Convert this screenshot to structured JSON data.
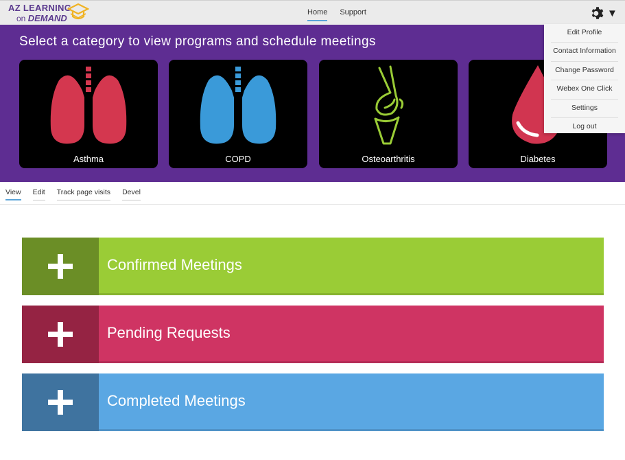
{
  "brand": {
    "line1": "AZ LEARNING",
    "line2_prefix": "on",
    "line2_emph": "DEMAND"
  },
  "topnav": {
    "items": [
      {
        "label": "Home",
        "active": true
      },
      {
        "label": "Support",
        "active": false
      }
    ]
  },
  "banner": {
    "title": "Select a category to view programs and schedule meetings"
  },
  "categories": [
    {
      "label": "Asthma",
      "icon": "lungs-icon",
      "color": "#d4374f"
    },
    {
      "label": "COPD",
      "icon": "lungs-icon",
      "color": "#3a9ad9"
    },
    {
      "label": "Osteoarthritis",
      "icon": "knee-joint-icon",
      "color": "#9acc36"
    },
    {
      "label": "Diabetes",
      "icon": "blood-drop-icon",
      "color": "#d13550"
    }
  ],
  "user_menu": {
    "items": [
      "Edit Profile",
      "Contact Information",
      "Change Password",
      "Webex One Click",
      "Settings",
      "Log out"
    ]
  },
  "local_tabs": [
    {
      "label": "View",
      "active": true
    },
    {
      "label": "Edit",
      "active": false
    },
    {
      "label": "Track page visits",
      "active": false
    },
    {
      "label": "Devel",
      "active": false
    }
  ],
  "sections": [
    {
      "label": "Confirmed Meetings",
      "color": "#9acc36",
      "dark": "#6b8e26"
    },
    {
      "label": "Pending Requests",
      "color": "#cf3463",
      "dark": "#952343"
    },
    {
      "label": "Completed Meetings",
      "color": "#5aa7e3",
      "dark": "#3f739f"
    }
  ],
  "colors": {
    "banner": "#5e2d92",
    "header": "#ebebeb",
    "accent": "#5aa3d8"
  }
}
